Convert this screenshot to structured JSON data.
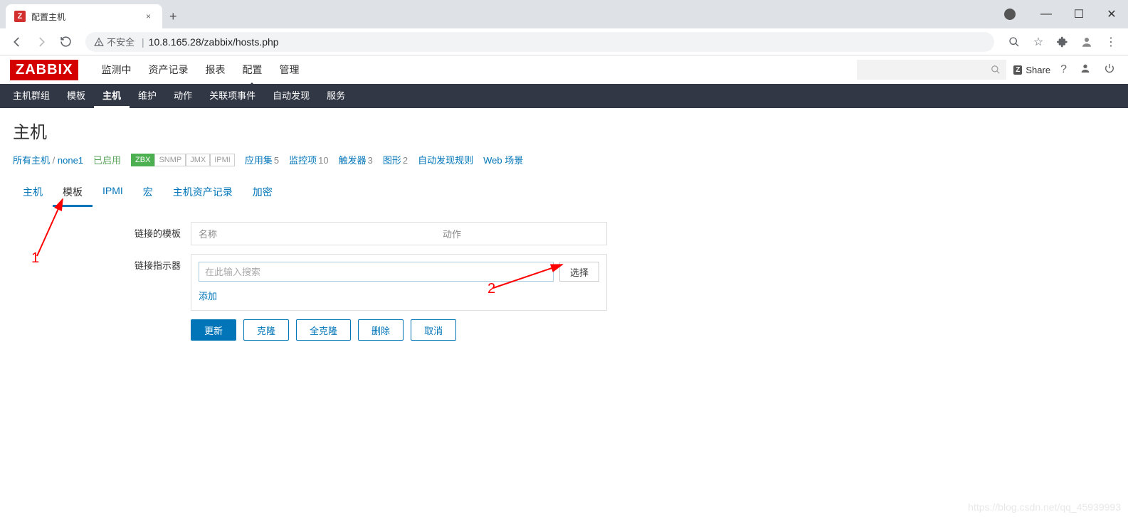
{
  "browser": {
    "tab_title": "配置主机",
    "url_prefix_warning": "不安全",
    "url": "10.8.165.28/zabbix/hosts.php"
  },
  "header": {
    "logo": "ZABBIX",
    "topnav": [
      "监测中",
      "资产记录",
      "报表",
      "配置",
      "管理"
    ],
    "topnav_active_index": 3,
    "share": "Share"
  },
  "subnav": {
    "items": [
      "主机群组",
      "模板",
      "主机",
      "维护",
      "动作",
      "关联项事件",
      "自动发现",
      "服务"
    ],
    "active_index": 2
  },
  "page_title": "主机",
  "breadcrumb": {
    "all_hosts": "所有主机",
    "host_name": "none1",
    "enabled": "已启用",
    "status_badges": [
      "ZBX",
      "SNMP",
      "JMX",
      "IPMI"
    ],
    "counts": [
      {
        "label": "应用集",
        "n": "5"
      },
      {
        "label": "监控项",
        "n": "10"
      },
      {
        "label": "触发器",
        "n": "3"
      },
      {
        "label": "图形",
        "n": "2"
      },
      {
        "label": "自动发现规则",
        "n": ""
      },
      {
        "label": "Web 场景",
        "n": ""
      }
    ]
  },
  "form_tabs": [
    "主机",
    "模板",
    "IPMI",
    "宏",
    "主机资产记录",
    "加密"
  ],
  "form_tab_active_index": 1,
  "form": {
    "linked_templates_label": "链接的模板",
    "table_head_name": "名称",
    "table_head_action": "动作",
    "link_indicator_label": "链接指示器",
    "search_placeholder": "在此输入搜索",
    "select_btn": "选择",
    "add_link": "添加"
  },
  "buttons": {
    "update": "更新",
    "clone": "克隆",
    "full_clone": "全克隆",
    "delete": "删除",
    "cancel": "取消"
  },
  "annotations": {
    "one": "1",
    "two": "2"
  },
  "watermark": "https://blog.csdn.net/qq_45939993"
}
